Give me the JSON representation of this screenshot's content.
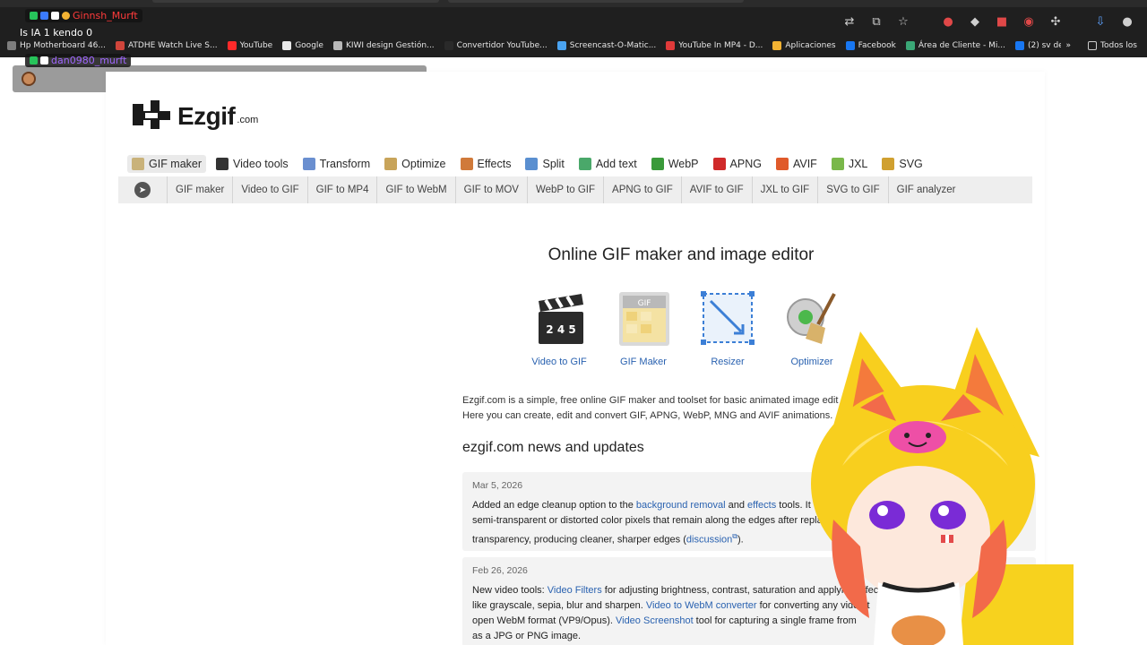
{
  "browser": {
    "bookmarks": [
      {
        "label": "Hp Motherboard 46...",
        "color": "#7d7d7d"
      },
      {
        "label": "ATDHE Watch Live S...",
        "color": "#d0453b"
      },
      {
        "label": "YouTube",
        "color": "#ff2a2a"
      },
      {
        "label": "Google",
        "color": "#e8e8e8"
      },
      {
        "label": "KIWI design Gestión...",
        "color": "#b8b8b8"
      },
      {
        "label": "Convertidor YouTube...",
        "color": "#2a2a2a"
      },
      {
        "label": "Screencast-O-Matic...",
        "color": "#4aa3f0"
      },
      {
        "label": "YouTube In MP4 - D...",
        "color": "#e03a3a"
      },
      {
        "label": "Aplicaciones",
        "color": "#f2b233"
      },
      {
        "label": "Facebook",
        "color": "#1877f2"
      },
      {
        "label": "Área de Cliente - Mi...",
        "color": "#3aa776"
      },
      {
        "label": "(2) sv de minecraft...",
        "color": "#1877f2"
      }
    ],
    "more_label": "»",
    "all_bookmarks": "Todos los"
  },
  "chat": {
    "user1": "Ginnsh_Murft",
    "message": "Is IA 1 kendo 0",
    "user2": "dan0980_murft"
  },
  "site": {
    "logo_text": "Ezgif",
    "logo_suffix": ".com",
    "main_nav": [
      {
        "label": "GIF maker",
        "icon": "gif-maker-icon",
        "active": true
      },
      {
        "label": "Video tools",
        "icon": "video-clapper-icon"
      },
      {
        "label": "Transform",
        "icon": "crop-icon"
      },
      {
        "label": "Optimize",
        "icon": "broom-icon"
      },
      {
        "label": "Effects",
        "icon": "magic-wand-icon"
      },
      {
        "label": "Split",
        "icon": "scissors-icon"
      },
      {
        "label": "Add text",
        "icon": "text-icon"
      },
      {
        "label": "WebP",
        "icon": "webp-icon"
      },
      {
        "label": "APNG",
        "icon": "apng-icon"
      },
      {
        "label": "AVIF",
        "icon": "avif-icon"
      },
      {
        "label": "JXL",
        "icon": "jxl-icon"
      },
      {
        "label": "SVG",
        "icon": "svg-icon"
      }
    ],
    "sub_nav": [
      "GIF maker",
      "Video to GIF",
      "GIF to MP4",
      "GIF to WebM",
      "GIF to MOV",
      "WebP to GIF",
      "APNG to GIF",
      "AVIF to GIF",
      "JXL to GIF",
      "SVG to GIF",
      "GIF analyzer"
    ],
    "page_title": "Online GIF maker and image editor",
    "tiles": [
      {
        "label": "Video to GIF",
        "icon": "video-clapper-icon"
      },
      {
        "label": "GIF Maker",
        "icon": "gif-maker-icon"
      },
      {
        "label": "Resizer",
        "icon": "resize-icon"
      },
      {
        "label": "Optimizer",
        "icon": "broom-icon"
      }
    ],
    "intro_line1": "Ezgif.com is a simple, free online GIF maker and toolset for basic animated image editing.",
    "intro_line2": "Here you can create, edit and convert GIF, APNG, WebP, MNG and AVIF animations.",
    "news_title": "ezgif.com news and updates",
    "news": [
      {
        "date": "Mar 5, 2026",
        "t1": "Added an edge cleanup option to the ",
        "l1": "background removal",
        "t2": " and ",
        "l2": "effects",
        "t3": " tools. It",
        "line2": "semi-transparent or distorted color pixels that remain along the edges after repla",
        "t4": "transparency, producing cleaner, sharper edges (",
        "l3": "discussion",
        "t5": ")."
      },
      {
        "date": "Feb 26, 2026",
        "t1": "New video tools: ",
        "l1": "Video Filters",
        "t2": " for adjusting brightness, contrast, saturation and applying effect",
        "t3": "like grayscale, sepia, blur and sharpen. ",
        "l2": "Video to WebM converter",
        "t4": " for converting any video t",
        "t5": "open WebM format (VP9/Opus). ",
        "l3": "Video Screenshot",
        "t6": " tool for capturing a single frame from",
        "t7": "as a JPG or PNG image."
      }
    ]
  }
}
